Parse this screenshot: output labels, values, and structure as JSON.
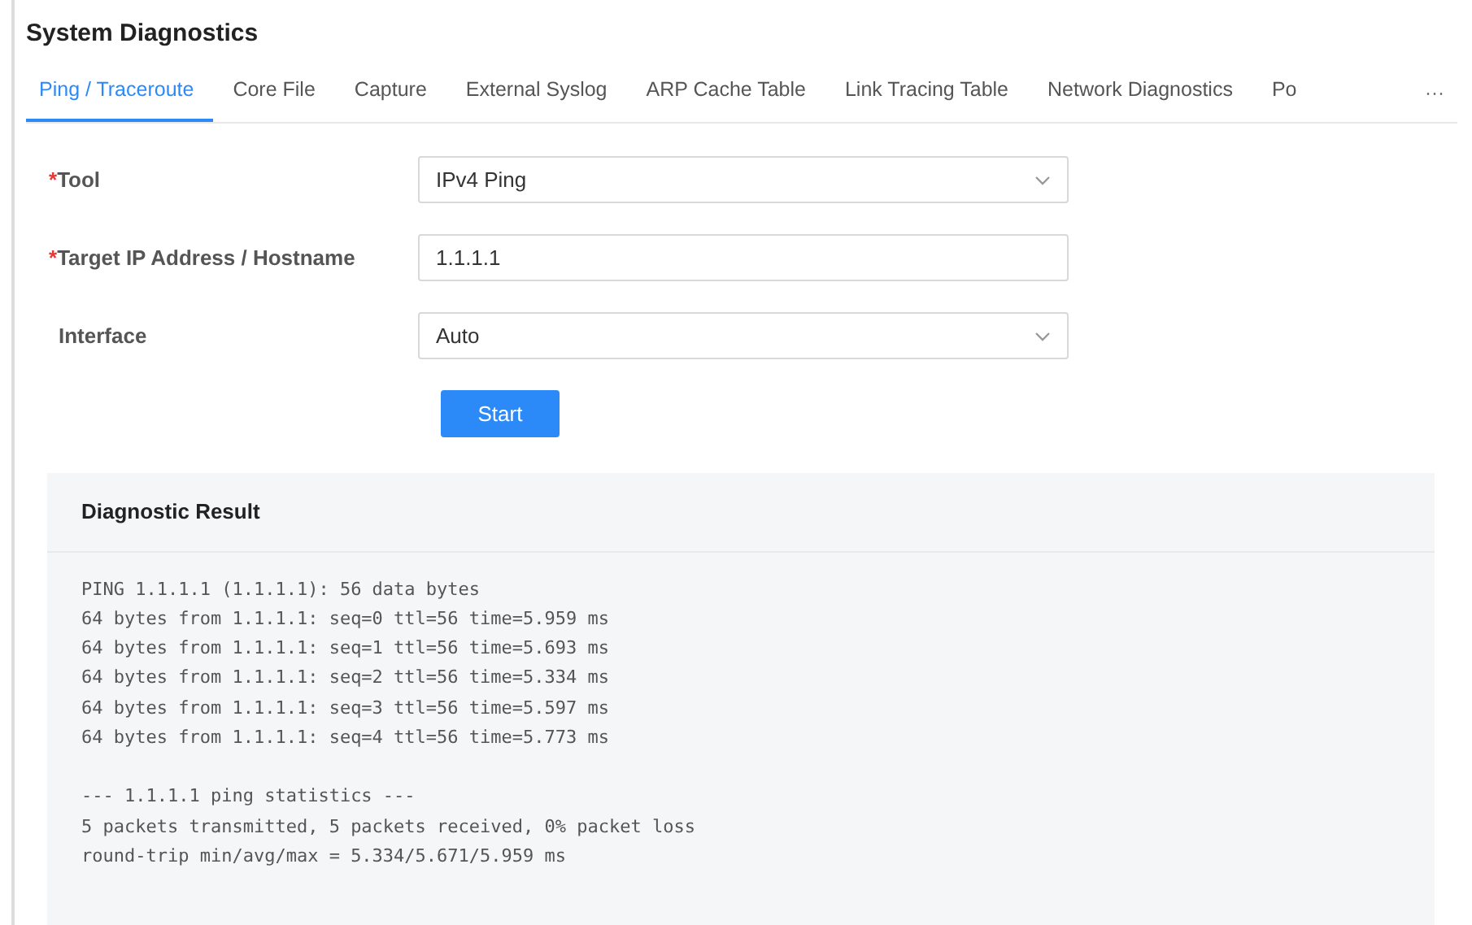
{
  "title": "System Diagnostics",
  "tabs": [
    {
      "label": "Ping / Traceroute",
      "selected": true
    },
    {
      "label": "Core File",
      "selected": false
    },
    {
      "label": "Capture",
      "selected": false
    },
    {
      "label": "External Syslog",
      "selected": false
    },
    {
      "label": "ARP Cache Table",
      "selected": false
    },
    {
      "label": "Link Tracing Table",
      "selected": false
    },
    {
      "label": "Network Diagnostics",
      "selected": false
    },
    {
      "label": "Po",
      "selected": false
    }
  ],
  "more_tabs": "···",
  "fields": [
    {
      "label": "Tool",
      "required": true,
      "kind": "select",
      "value": "IPv4 Ping"
    },
    {
      "label": "Target IP Address / Hostname",
      "required": true,
      "kind": "input",
      "value": "1.1.1.1"
    },
    {
      "label": "Interface",
      "required": false,
      "kind": "select",
      "value": "Auto"
    }
  ],
  "required_mark": "*",
  "start_button": "Start",
  "result": {
    "title": "Diagnostic Result",
    "blocks": [
      [
        "PING 1.1.1.1 (1.1.1.1): 56 data bytes",
        "64 bytes from 1.1.1.1: seq=0 ttl=56 time=5.959 ms",
        "64 bytes from 1.1.1.1: seq=1 ttl=56 time=5.693 ms",
        "64 bytes from 1.1.1.1: seq=2 ttl=56 time=5.334 ms",
        "64 bytes from 1.1.1.1: seq=3 ttl=56 time=5.597 ms",
        "64 bytes from 1.1.1.1: seq=4 ttl=56 time=5.773 ms"
      ],
      [
        "--- 1.1.1.1 ping statistics ---",
        "5 packets transmitted, 5 packets received, 0% packet loss",
        "round-trip min/avg/max = 5.334/5.671/5.959 ms"
      ]
    ]
  }
}
